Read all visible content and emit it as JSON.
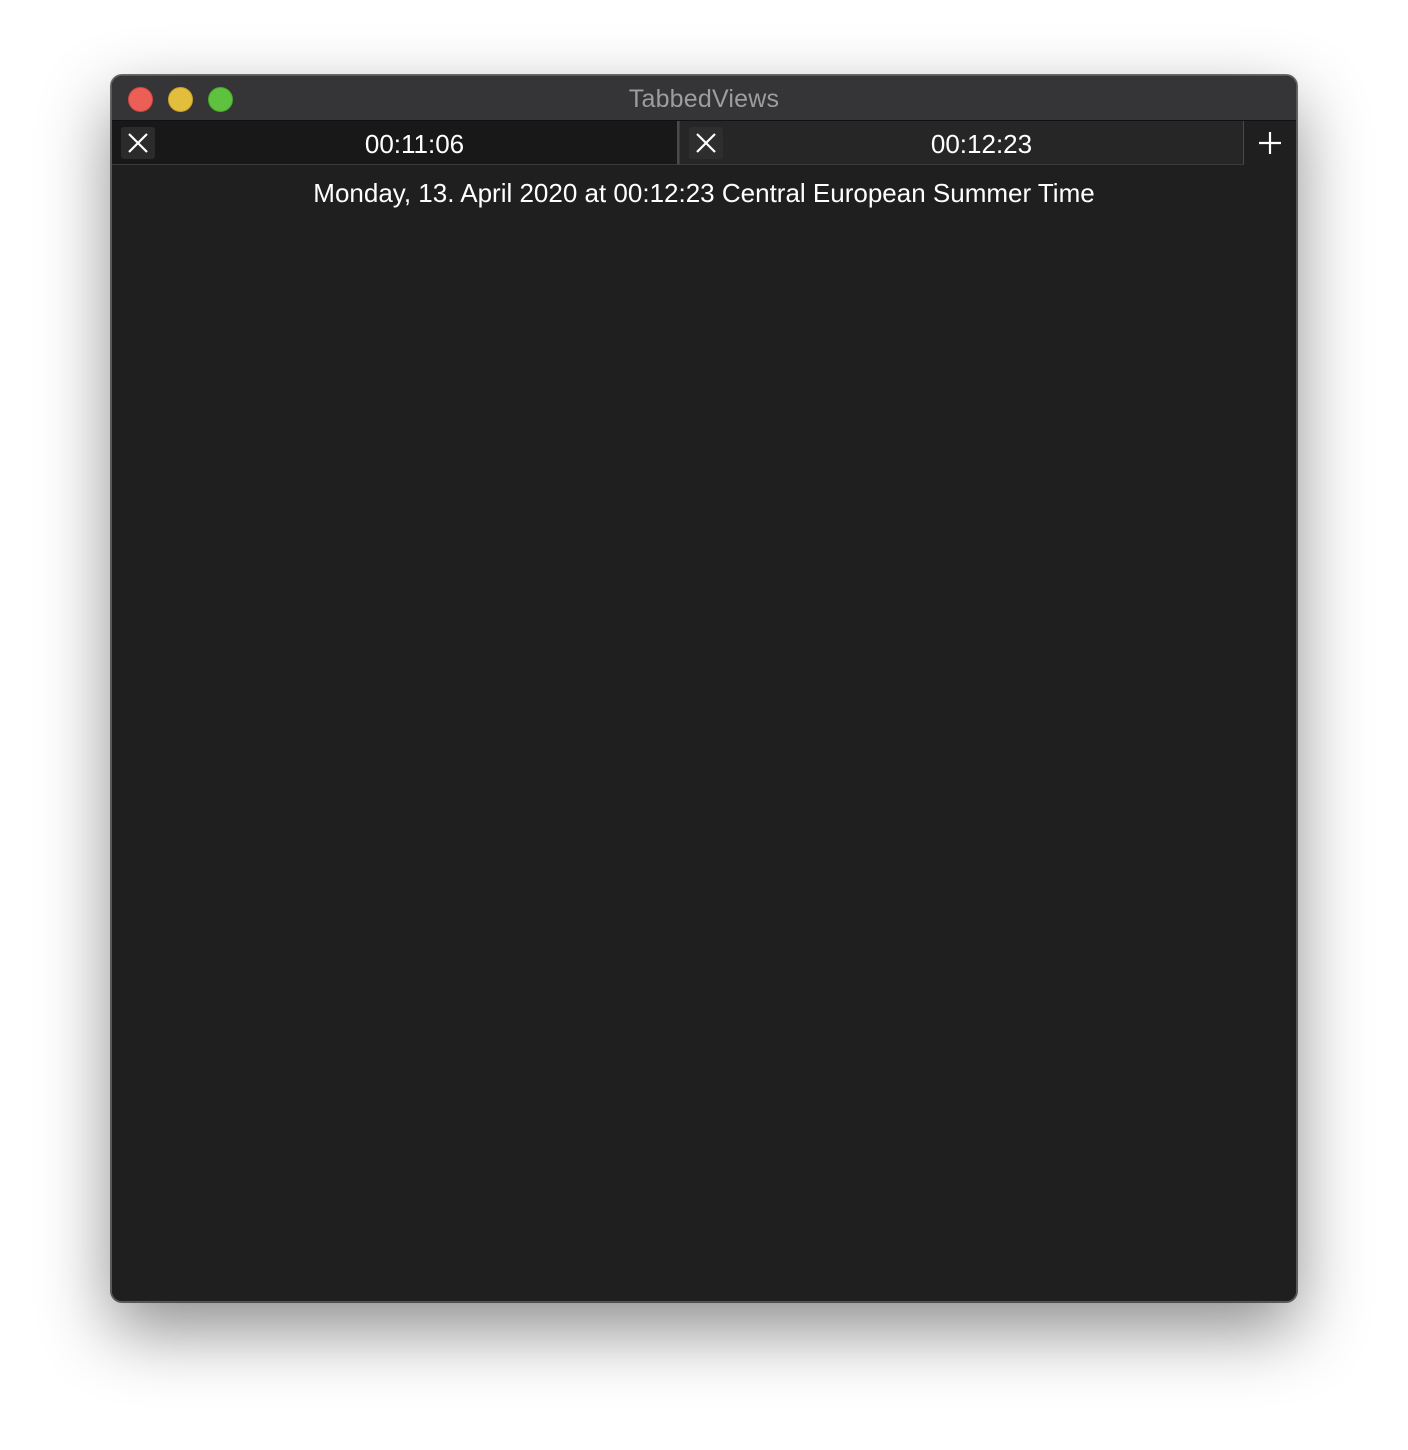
{
  "window": {
    "title": "TabbedViews"
  },
  "traffic_lights": {
    "close_color": "#ec5f57",
    "minimize_color": "#e3bd3c",
    "maximize_color": "#5fc23f"
  },
  "tabs": [
    {
      "label": "00:11:06",
      "close_icon": "close-icon"
    },
    {
      "label": "00:12:23",
      "close_icon": "close-icon"
    }
  ],
  "add_tab_icon": "plus-icon",
  "content": {
    "date_text": "Monday, 13. April 2020 at 00:12:23 Central European Summer Time"
  }
}
